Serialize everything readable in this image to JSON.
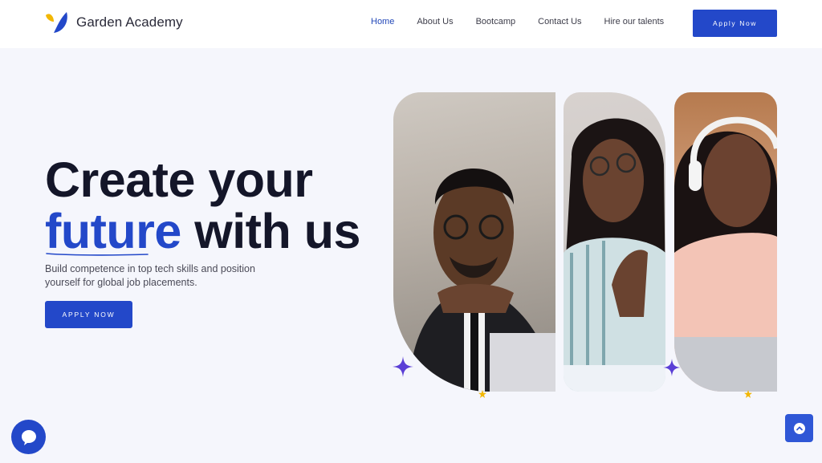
{
  "header": {
    "logo_text": "Garden Academy",
    "nav": [
      {
        "label": "Home",
        "active": true
      },
      {
        "label": "About Us",
        "active": false
      },
      {
        "label": "Bootcamp",
        "active": false
      },
      {
        "label": "Contact Us",
        "active": false
      },
      {
        "label": "Hire our talents",
        "active": false
      }
    ],
    "cta_label": "Apply Now"
  },
  "hero": {
    "title_line1": "Create your",
    "title_accent": "future",
    "title_rest": " with us",
    "subtitle": "Build competence in top tech skills and position yourself for global job placements.",
    "cta_label": "APPLY NOW"
  },
  "icons": {
    "chat": "chat-bubble-icon",
    "scroll_top": "chevron-up-circle-icon"
  },
  "colors": {
    "accent": "#2348c9",
    "logo_yellow": "#f2b705",
    "sparkle": "#5b3fd6",
    "background": "#f5f6fc"
  }
}
